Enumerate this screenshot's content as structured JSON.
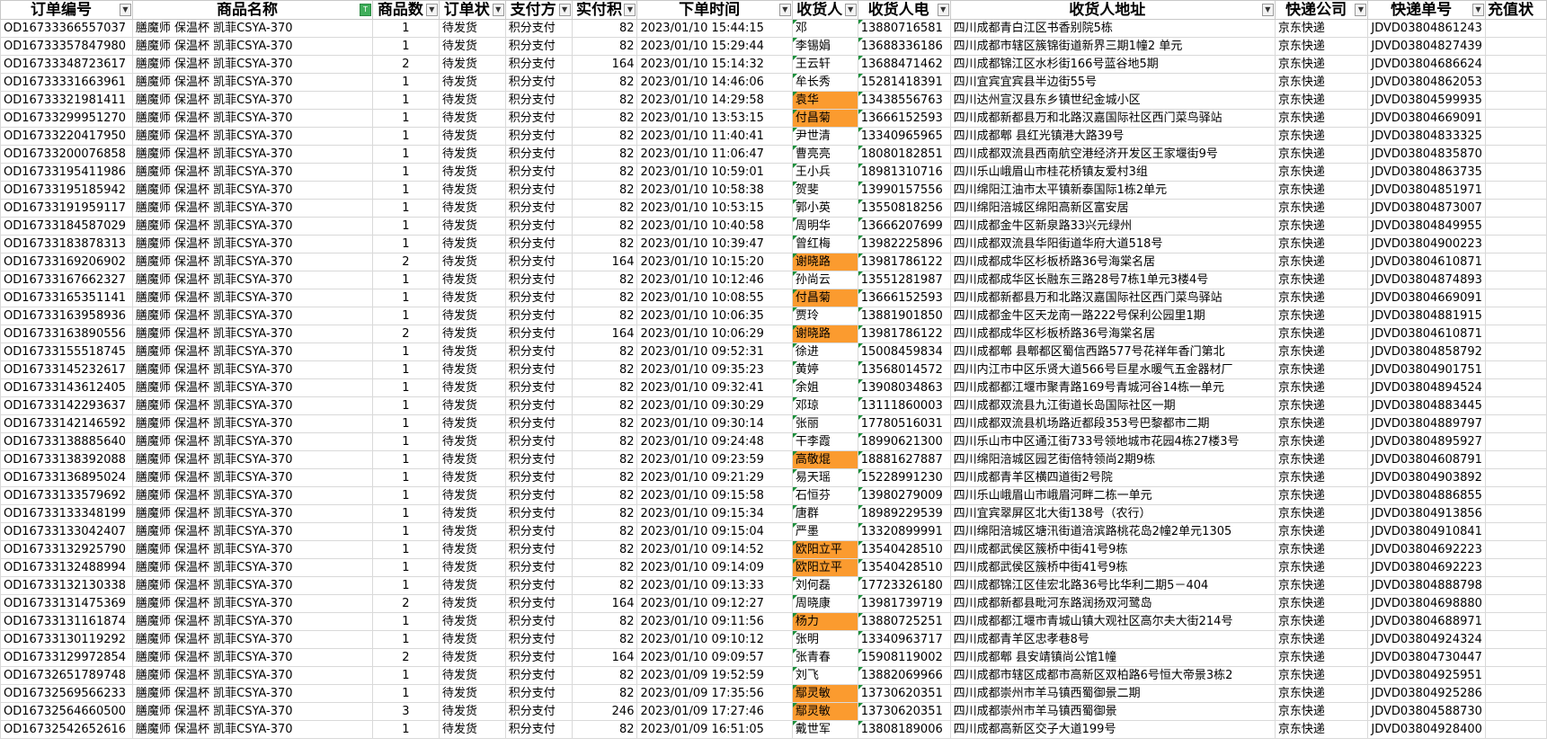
{
  "headers": [
    "订单编号",
    "商品名称",
    "商品数",
    "订单状",
    "支付方",
    "实付积",
    "下单时间",
    "收货人",
    "收货人电",
    "收货人地址",
    "快递公司",
    "快递单号",
    "充值状"
  ],
  "rows": [
    {
      "id": "OD16733366557037",
      "product": "膳魔师 保温杯 凯菲CSYA-370",
      "qty": "1",
      "status": "待发货",
      "pay": "积分支付",
      "amount": "82",
      "time": "2023/01/10 15:44:15",
      "name": "邓",
      "phone": "13880716581",
      "address": "四川成都青白江区书香别院5栋",
      "courier": "京东快递",
      "tracking": "JDVD03804861243",
      "hl": false
    },
    {
      "id": "OD16733357847980",
      "product": "膳魔师 保温杯 凯菲CSYA-370",
      "qty": "1",
      "status": "待发货",
      "pay": "积分支付",
      "amount": "82",
      "time": "2023/01/10 15:29:44",
      "name": "李锡娟",
      "phone": "13688336186",
      "address": "四川成都市辖区簇锦街道新界三期1幢2 单元",
      "courier": "京东快递",
      "tracking": "JDVD03804827439",
      "hl": false
    },
    {
      "id": "OD16733348723617",
      "product": "膳魔师 保温杯 凯菲CSYA-370",
      "qty": "2",
      "status": "待发货",
      "pay": "积分支付",
      "amount": "164",
      "time": "2023/01/10 15:14:32",
      "name": "王云轩",
      "phone": "13688471462",
      "address": "四川成都锦江区水杉街166号蓝谷地5期",
      "courier": "京东快递",
      "tracking": "JDVD03804686624",
      "hl": false
    },
    {
      "id": "OD16733331663961",
      "product": "膳魔师 保温杯 凯菲CSYA-370",
      "qty": "1",
      "status": "待发货",
      "pay": "积分支付",
      "amount": "82",
      "time": "2023/01/10 14:46:06",
      "name": "牟长秀",
      "phone": "15281418391",
      "address": "四川宜宾宜宾县半边街55号",
      "courier": "京东快递",
      "tracking": "JDVD03804862053",
      "hl": false
    },
    {
      "id": "OD16733321981411",
      "product": "膳魔师 保温杯 凯菲CSYA-370",
      "qty": "1",
      "status": "待发货",
      "pay": "积分支付",
      "amount": "82",
      "time": "2023/01/10 14:29:58",
      "name": "袁华",
      "phone": "13438556763",
      "address": "四川达州宣汉县东乡镇世纪金城小区",
      "courier": "京东快递",
      "tracking": "JDVD03804599935",
      "hl": true
    },
    {
      "id": "OD16733299951270",
      "product": "膳魔师 保温杯 凯菲CSYA-370",
      "qty": "1",
      "status": "待发货",
      "pay": "积分支付",
      "amount": "82",
      "time": "2023/01/10 13:53:15",
      "name": "付昌菊",
      "phone": "13666152593",
      "address": "四川成都新都县万和北路汉嘉国际社区西门菜鸟驿站",
      "courier": "京东快递",
      "tracking": "JDVD03804669091",
      "hl": true
    },
    {
      "id": "OD16733220417950",
      "product": "膳魔师 保温杯 凯菲CSYA-370",
      "qty": "1",
      "status": "待发货",
      "pay": "积分支付",
      "amount": "82",
      "time": "2023/01/10 11:40:41",
      "name": "尹世清",
      "phone": "13340965965",
      "address": "四川成都郫 县红光镇港大路39号",
      "courier": "京东快递",
      "tracking": "JDVD03804833325",
      "hl": false
    },
    {
      "id": "OD16733200076858",
      "product": "膳魔师 保温杯 凯菲CSYA-370",
      "qty": "1",
      "status": "待发货",
      "pay": "积分支付",
      "amount": "82",
      "time": "2023/01/10 11:06:47",
      "name": "曹亮亮",
      "phone": "18080182851",
      "address": "四川成都双流县西南航空港经济开发区王家堰街9号",
      "courier": "京东快递",
      "tracking": "JDVD03804835870",
      "hl": false
    },
    {
      "id": "OD16733195411986",
      "product": "膳魔师 保温杯 凯菲CSYA-370",
      "qty": "1",
      "status": "待发货",
      "pay": "积分支付",
      "amount": "82",
      "time": "2023/01/10 10:59:01",
      "name": "王小兵",
      "phone": "18981310716",
      "address": "四川乐山峨眉山市桂花桥镇友爱村3组",
      "courier": "京东快递",
      "tracking": "JDVD03804863735",
      "hl": false
    },
    {
      "id": "OD16733195185942",
      "product": "膳魔师 保温杯 凯菲CSYA-370",
      "qty": "1",
      "status": "待发货",
      "pay": "积分支付",
      "amount": "82",
      "time": "2023/01/10 10:58:38",
      "name": "贺斐",
      "phone": "13990157556",
      "address": "四川绵阳江油市太平镇新泰国际1栋2单元",
      "courier": "京东快递",
      "tracking": "JDVD03804851971",
      "hl": false
    },
    {
      "id": "OD16733191959117",
      "product": "膳魔师 保温杯 凯菲CSYA-370",
      "qty": "1",
      "status": "待发货",
      "pay": "积分支付",
      "amount": "82",
      "time": "2023/01/10 10:53:15",
      "name": "郭小英",
      "phone": "13550818256",
      "address": "四川绵阳涪城区绵阳高新区富安居",
      "courier": "京东快递",
      "tracking": "JDVD03804873007",
      "hl": false
    },
    {
      "id": "OD16733184587029",
      "product": "膳魔师 保温杯 凯菲CSYA-370",
      "qty": "1",
      "status": "待发货",
      "pay": "积分支付",
      "amount": "82",
      "time": "2023/01/10 10:40:58",
      "name": "周明华",
      "phone": "13666207699",
      "address": "四川成都金牛区新泉路33兴元绿州",
      "courier": "京东快递",
      "tracking": "JDVD03804849955",
      "hl": false
    },
    {
      "id": "OD16733183878313",
      "product": "膳魔师 保温杯 凯菲CSYA-370",
      "qty": "1",
      "status": "待发货",
      "pay": "积分支付",
      "amount": "82",
      "time": "2023/01/10 10:39:47",
      "name": "曾红梅",
      "phone": "13982225896",
      "address": "四川成都双流县华阳街道华府大道518号",
      "courier": "京东快递",
      "tracking": "JDVD03804900223",
      "hl": false
    },
    {
      "id": "OD16733169206902",
      "product": "膳魔师 保温杯 凯菲CSYA-370",
      "qty": "2",
      "status": "待发货",
      "pay": "积分支付",
      "amount": "164",
      "time": "2023/01/10 10:15:20",
      "name": "谢晓路",
      "phone": "13981786122",
      "address": "四川成都成华区杉板桥路36号海棠名居",
      "courier": "京东快递",
      "tracking": "JDVD03804610871",
      "hl": true
    },
    {
      "id": "OD16733167662327",
      "product": "膳魔师 保温杯 凯菲CSYA-370",
      "qty": "1",
      "status": "待发货",
      "pay": "积分支付",
      "amount": "82",
      "time": "2023/01/10 10:12:46",
      "name": "孙尚云",
      "phone": "13551281987",
      "address": "四川成都成华区长融东三路28号7栋1单元3楼4号",
      "courier": "京东快递",
      "tracking": "JDVD03804874893",
      "hl": false
    },
    {
      "id": "OD16733165351141",
      "product": "膳魔师 保温杯 凯菲CSYA-370",
      "qty": "1",
      "status": "待发货",
      "pay": "积分支付",
      "amount": "82",
      "time": "2023/01/10 10:08:55",
      "name": "付昌菊",
      "phone": "13666152593",
      "address": "四川成都新都县万和北路汉嘉国际社区西门菜鸟驿站",
      "courier": "京东快递",
      "tracking": "JDVD03804669091",
      "hl": true
    },
    {
      "id": "OD16733163958936",
      "product": "膳魔师 保温杯 凯菲CSYA-370",
      "qty": "1",
      "status": "待发货",
      "pay": "积分支付",
      "amount": "82",
      "time": "2023/01/10 10:06:35",
      "name": "贾玲",
      "phone": "13881901850",
      "address": "四川成都金牛区天龙南一路222号保利公园里1期",
      "courier": "京东快递",
      "tracking": "JDVD03804881915",
      "hl": false
    },
    {
      "id": "OD16733163890556",
      "product": "膳魔师 保温杯 凯菲CSYA-370",
      "qty": "2",
      "status": "待发货",
      "pay": "积分支付",
      "amount": "164",
      "time": "2023/01/10 10:06:29",
      "name": "谢晓路",
      "phone": "13981786122",
      "address": "四川成都成华区杉板桥路36号海棠名居",
      "courier": "京东快递",
      "tracking": "JDVD03804610871",
      "hl": true
    },
    {
      "id": "OD16733155518745",
      "product": "膳魔师 保温杯 凯菲CSYA-370",
      "qty": "1",
      "status": "待发货",
      "pay": "积分支付",
      "amount": "82",
      "time": "2023/01/10 09:52:31",
      "name": "徐进",
      "phone": "15008459834",
      "address": "四川成都郫 县郫都区蜀信西路577号花祥年香门第北",
      "courier": "京东快递",
      "tracking": "JDVD03804858792",
      "hl": false
    },
    {
      "id": "OD16733145232617",
      "product": "膳魔师 保温杯 凯菲CSYA-370",
      "qty": "1",
      "status": "待发货",
      "pay": "积分支付",
      "amount": "82",
      "time": "2023/01/10 09:35:23",
      "name": "黄婷",
      "phone": "13568014572",
      "address": "四川内江市中区乐贤大道566号巨星水暖气五金器材厂",
      "courier": "京东快递",
      "tracking": "JDVD03804901751",
      "hl": false
    },
    {
      "id": "OD16733143612405",
      "product": "膳魔师 保温杯 凯菲CSYA-370",
      "qty": "1",
      "status": "待发货",
      "pay": "积分支付",
      "amount": "82",
      "time": "2023/01/10 09:32:41",
      "name": "余姐",
      "phone": "13908034863",
      "address": "四川成都都江堰市聚青路169号青城河谷14栋一单元",
      "courier": "京东快递",
      "tracking": "JDVD03804894524",
      "hl": false
    },
    {
      "id": "OD16733142293637",
      "product": "膳魔师 保温杯 凯菲CSYA-370",
      "qty": "1",
      "status": "待发货",
      "pay": "积分支付",
      "amount": "82",
      "time": "2023/01/10 09:30:29",
      "name": "邓琼",
      "phone": "13111860003",
      "address": "四川成都双流县九江街道长岛国际社区一期",
      "courier": "京东快递",
      "tracking": "JDVD03804883445",
      "hl": false
    },
    {
      "id": "OD16733142146592",
      "product": "膳魔师 保温杯 凯菲CSYA-370",
      "qty": "1",
      "status": "待发货",
      "pay": "积分支付",
      "amount": "82",
      "time": "2023/01/10 09:30:14",
      "name": "张丽",
      "phone": "17780516031",
      "address": "四川成都双流县机场路近都段353号巴黎都市二期",
      "courier": "京东快递",
      "tracking": "JDVD03804889797",
      "hl": false
    },
    {
      "id": "OD16733138885640",
      "product": "膳魔师 保温杯 凯菲CSYA-370",
      "qty": "1",
      "status": "待发货",
      "pay": "积分支付",
      "amount": "82",
      "time": "2023/01/10 09:24:48",
      "name": "干李霞",
      "phone": "18990621300",
      "address": "四川乐山市中区通江街733号领地城市花园4栋27楼3号",
      "courier": "京东快递",
      "tracking": "JDVD03804895927",
      "hl": false
    },
    {
      "id": "OD16733138392088",
      "product": "膳魔师 保温杯 凯菲CSYA-370",
      "qty": "1",
      "status": "待发货",
      "pay": "积分支付",
      "amount": "82",
      "time": "2023/01/10 09:23:59",
      "name": "高敬焜",
      "phone": "18881627887",
      "address": "四川绵阳涪城区园艺街倍特领尚2期9栋",
      "courier": "京东快递",
      "tracking": "JDVD03804608791",
      "hl": true
    },
    {
      "id": "OD16733136895024",
      "product": "膳魔师 保温杯 凯菲CSYA-370",
      "qty": "1",
      "status": "待发货",
      "pay": "积分支付",
      "amount": "82",
      "time": "2023/01/10 09:21:29",
      "name": "易天瑶",
      "phone": "15228991230",
      "address": "四川成都青羊区横四道街2号院",
      "courier": "京东快递",
      "tracking": "JDVD03804903892",
      "hl": false
    },
    {
      "id": "OD16733133579692",
      "product": "膳魔师 保温杯 凯菲CSYA-370",
      "qty": "1",
      "status": "待发货",
      "pay": "积分支付",
      "amount": "82",
      "time": "2023/01/10 09:15:58",
      "name": "石恒芬",
      "phone": "13980279009",
      "address": "四川乐山峨眉山市峨眉河畔二栋一单元",
      "courier": "京东快递",
      "tracking": "JDVD03804886855",
      "hl": false
    },
    {
      "id": "OD16733133348199",
      "product": "膳魔师 保温杯 凯菲CSYA-370",
      "qty": "1",
      "status": "待发货",
      "pay": "积分支付",
      "amount": "82",
      "time": "2023/01/10 09:15:34",
      "name": "唐群",
      "phone": "18989229539",
      "address": "四川宜宾翠屏区北大街138号（农行）",
      "courier": "京东快递",
      "tracking": "JDVD03804913856",
      "hl": false
    },
    {
      "id": "OD16733133042407",
      "product": "膳魔师 保温杯 凯菲CSYA-370",
      "qty": "1",
      "status": "待发货",
      "pay": "积分支付",
      "amount": "82",
      "time": "2023/01/10 09:15:04",
      "name": "严墨",
      "phone": "13320899991",
      "address": "四川绵阳涪城区塘汛街道涪滨路桃花岛2幢2单元1305",
      "courier": "京东快递",
      "tracking": "JDVD03804910841",
      "hl": false
    },
    {
      "id": "OD16733132925790",
      "product": "膳魔师 保温杯 凯菲CSYA-370",
      "qty": "1",
      "status": "待发货",
      "pay": "积分支付",
      "amount": "82",
      "time": "2023/01/10 09:14:52",
      "name": "欧阳立平",
      "phone": "13540428510",
      "address": "四川成都武侯区簇桥中街41号9栋",
      "courier": "京东快递",
      "tracking": "JDVD03804692223",
      "hl": true
    },
    {
      "id": "OD16733132488994",
      "product": "膳魔师 保温杯 凯菲CSYA-370",
      "qty": "1",
      "status": "待发货",
      "pay": "积分支付",
      "amount": "82",
      "time": "2023/01/10 09:14:09",
      "name": "欧阳立平",
      "phone": "13540428510",
      "address": "四川成都武侯区簇桥中街41号9栋",
      "courier": "京东快递",
      "tracking": "JDVD03804692223",
      "hl": true
    },
    {
      "id": "OD16733132130338",
      "product": "膳魔师 保温杯 凯菲CSYA-370",
      "qty": "1",
      "status": "待发货",
      "pay": "积分支付",
      "amount": "82",
      "time": "2023/01/10 09:13:33",
      "name": "刘何磊",
      "phone": "17723326180",
      "address": "四川成都锦江区佳宏北路36号比华利二期5－404",
      "courier": "京东快递",
      "tracking": "JDVD03804888798",
      "hl": false
    },
    {
      "id": "OD16733131475369",
      "product": "膳魔师 保温杯 凯菲CSYA-370",
      "qty": "2",
      "status": "待发货",
      "pay": "积分支付",
      "amount": "164",
      "time": "2023/01/10 09:12:27",
      "name": "周晓康",
      "phone": "13981739719",
      "address": "四川成都新都县毗河东路润扬双河鹭岛",
      "courier": "京东快递",
      "tracking": "JDVD03804698880",
      "hl": false
    },
    {
      "id": "OD16733131161874",
      "product": "膳魔师 保温杯 凯菲CSYA-370",
      "qty": "1",
      "status": "待发货",
      "pay": "积分支付",
      "amount": "82",
      "time": "2023/01/10 09:11:56",
      "name": "杨力",
      "phone": "13880725251",
      "address": "四川成都都江堰市青城山镇大观社区高尔夫大街214号",
      "courier": "京东快递",
      "tracking": "JDVD03804688971",
      "hl": true
    },
    {
      "id": "OD16733130119292",
      "product": "膳魔师 保温杯 凯菲CSYA-370",
      "qty": "1",
      "status": "待发货",
      "pay": "积分支付",
      "amount": "82",
      "time": "2023/01/10 09:10:12",
      "name": "张明",
      "phone": "13340963717",
      "address": "四川成都青羊区忠孝巷8号",
      "courier": "京东快递",
      "tracking": "JDVD03804924324",
      "hl": false
    },
    {
      "id": "OD16733129972854",
      "product": "膳魔师 保温杯 凯菲CSYA-370",
      "qty": "2",
      "status": "待发货",
      "pay": "积分支付",
      "amount": "164",
      "time": "2023/01/10 09:09:57",
      "name": "张青春",
      "phone": "15908119002",
      "address": "四川成都郫 县安靖镇尚公馆1幢",
      "courier": "京东快递",
      "tracking": "JDVD03804730447",
      "hl": false
    },
    {
      "id": "OD16732651789748",
      "product": "膳魔师 保温杯 凯菲CSYA-370",
      "qty": "1",
      "status": "待发货",
      "pay": "积分支付",
      "amount": "82",
      "time": "2023/01/09 19:52:59",
      "name": "刘飞",
      "phone": "13882069966",
      "address": "四川成都市辖区成都市高新区双柏路6号恒大帝景3栋2",
      "courier": "京东快递",
      "tracking": "JDVD03804925951",
      "hl": false
    },
    {
      "id": "OD16732569566233",
      "product": "膳魔师 保温杯 凯菲CSYA-370",
      "qty": "1",
      "status": "待发货",
      "pay": "积分支付",
      "amount": "82",
      "time": "2023/01/09 17:35:56",
      "name": "鄢灵敏",
      "phone": "13730620351",
      "address": "四川成都崇州市羊马镇西蜀御景二期",
      "courier": "京东快递",
      "tracking": "JDVD03804925286",
      "hl": true
    },
    {
      "id": "OD16732564660500",
      "product": "膳魔师 保温杯 凯菲CSYA-370",
      "qty": "3",
      "status": "待发货",
      "pay": "积分支付",
      "amount": "246",
      "time": "2023/01/09 17:27:46",
      "name": "鄢灵敏",
      "phone": "13730620351",
      "address": "四川成都崇州市羊马镇西蜀御景",
      "courier": "京东快递",
      "tracking": "JDVD03804588730",
      "hl": true
    },
    {
      "id": "OD16732542652616",
      "product": "膳魔师 保温杯 凯菲CSYA-370",
      "qty": "1",
      "status": "待发货",
      "pay": "积分支付",
      "amount": "82",
      "time": "2023/01/09 16:51:05",
      "name": "戴世军",
      "phone": "13808189006",
      "address": "四川成都高新区交子大道199号",
      "courier": "京东快递",
      "tracking": "JDVD03804928400",
      "hl": false
    }
  ],
  "colors": {
    "highlight": "#fb9b2f",
    "grid": "#d9d9d9",
    "filter_active": "#3fae5a"
  }
}
